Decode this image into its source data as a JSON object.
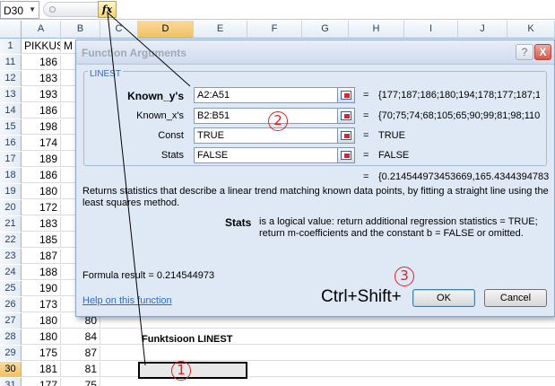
{
  "formula_bar": {
    "name_box": "D30",
    "fx_label": "fx"
  },
  "columns": [
    "A",
    "B",
    "C",
    "D",
    "E",
    "F",
    "G",
    "H",
    "I",
    "J",
    "K"
  ],
  "header_row": {
    "row": "1",
    "a": "PIKKUS",
    "b": "M"
  },
  "rows": [
    {
      "row": "11",
      "a": "186",
      "b": ""
    },
    {
      "row": "12",
      "a": "183",
      "b": ""
    },
    {
      "row": "13",
      "a": "193",
      "b": ""
    },
    {
      "row": "14",
      "a": "186",
      "b": ""
    },
    {
      "row": "15",
      "a": "198",
      "b": ""
    },
    {
      "row": "16",
      "a": "174",
      "b": ""
    },
    {
      "row": "17",
      "a": "189",
      "b": ""
    },
    {
      "row": "18",
      "a": "186",
      "b": ""
    },
    {
      "row": "19",
      "a": "180",
      "b": ""
    },
    {
      "row": "20",
      "a": "172",
      "b": ""
    },
    {
      "row": "21",
      "a": "183",
      "b": ""
    },
    {
      "row": "22",
      "a": "185",
      "b": ""
    },
    {
      "row": "23",
      "a": "187",
      "b": ""
    },
    {
      "row": "24",
      "a": "188",
      "b": ""
    },
    {
      "row": "25",
      "a": "190",
      "b": ""
    },
    {
      "row": "26",
      "a": "173",
      "b": ""
    },
    {
      "row": "27",
      "a": "180",
      "b": "80"
    },
    {
      "row": "28",
      "a": "180",
      "b": "84"
    },
    {
      "row": "29",
      "a": "175",
      "b": "87"
    },
    {
      "row": "30",
      "a": "181",
      "b": "81"
    },
    {
      "row": "31",
      "a": "177",
      "b": "75"
    }
  ],
  "cell_label": "Funktsioon LINEST",
  "dialog": {
    "title": "Function Arguments",
    "help_button": "?",
    "close_button": "X",
    "function_name": "LINEST",
    "args": [
      {
        "label": "Known_y's",
        "value": "A2:A51",
        "result": "{177;187;186;180;194;178;177;187;18"
      },
      {
        "label": "Known_x's",
        "value": "B2:B51",
        "result": "{70;75;74;68;105;65;90;99;81;98;110;"
      },
      {
        "label": "Const",
        "value": "TRUE",
        "result": "TRUE"
      },
      {
        "label": "Stats",
        "value": "FALSE",
        "result": "FALSE"
      }
    ],
    "eq_sign": "=",
    "function_result": "{0.214544973453669,165.4344394783",
    "description": "Returns statistics that describe a linear trend matching known data points, by fitting a straight line using the least squares method.",
    "stats_name": "Stats",
    "stats_description": "is a logical value: return additional regression statistics = TRUE; return m-coefficients and the constant b = FALSE or omitted.",
    "formula_result": "Formula result =   0.214544973",
    "help_link": "Help on this function",
    "ok_label": "OK",
    "cancel_label": "Cancel"
  },
  "annotations": {
    "keys_text": "Ctrl+Shift+",
    "step1": "1",
    "step2": "2",
    "step3": "3"
  },
  "colors": {
    "annotation": "#e02020",
    "dialog_bg": "#dfe8f5",
    "link": "#2a6ccb"
  }
}
